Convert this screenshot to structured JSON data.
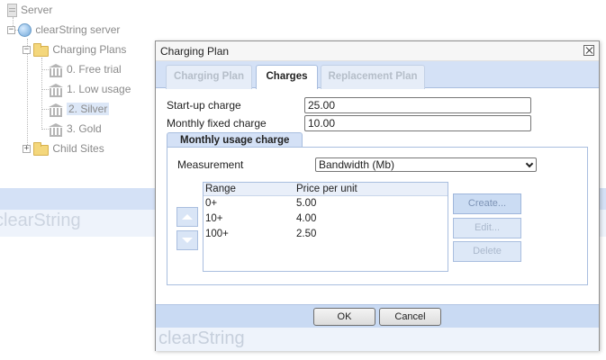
{
  "tree": {
    "server_label": "Server",
    "server_name": "clearString server",
    "charging_plans_label": "Charging Plans",
    "plans": [
      "0. Free trial",
      "1. Low usage",
      "2. Silver",
      "3. Gold"
    ],
    "selected_plan": "2. Silver",
    "child_sites_label": "Child Sites"
  },
  "background_brand": "clearString",
  "dialog": {
    "title": "Charging Plan",
    "tabs": [
      {
        "label": "Charging Plan",
        "active": false
      },
      {
        "label": "Charges",
        "active": true
      },
      {
        "label": "Replacement Plan",
        "active": false
      }
    ],
    "startup_label": "Start-up charge",
    "startup_value": "25.00",
    "monthly_fixed_label": "Monthly fixed charge",
    "monthly_fixed_value": "10.00",
    "usage_section_label": "Monthly usage charge",
    "measurement_label": "Measurement",
    "measurement_value": "Bandwidth (Mb)",
    "grid": {
      "columns": [
        "Range",
        "Price per unit"
      ],
      "rows": [
        [
          "0+",
          "5.00"
        ],
        [
          "10+",
          "4.00"
        ],
        [
          "100+",
          "2.50"
        ]
      ]
    },
    "buttons": {
      "create": "Create...",
      "edit": "Edit...",
      "delete": "Delete",
      "ok": "OK",
      "cancel": "Cancel"
    },
    "brand": "clearString"
  },
  "colors": {
    "accent": "#d4e1f6",
    "footer": "#c9daf3"
  }
}
